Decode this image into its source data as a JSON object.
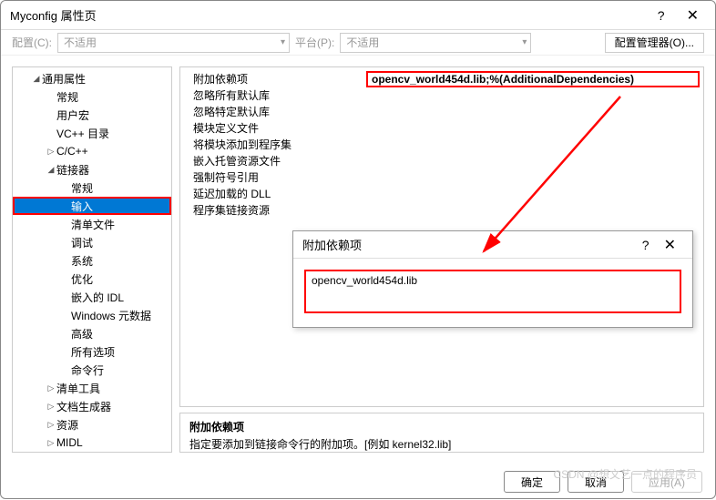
{
  "titlebar": {
    "title": "Myconfig 属性页",
    "help_label": "?",
    "close_label": "✕"
  },
  "config_row": {
    "config_label": "配置(C):",
    "config_value": "不适用",
    "platform_label": "平台(P):",
    "platform_value": "不适用",
    "manager_btn": "配置管理器(O)..."
  },
  "tree": {
    "root": "通用属性",
    "items": [
      "常规",
      "用户宏",
      "VC++ 目录",
      "C/C++",
      "链接器"
    ],
    "linker_children": [
      "常规",
      "输入",
      "清单文件",
      "调试",
      "系统",
      "优化",
      "嵌入的 IDL",
      "Windows 元数据",
      "高级",
      "所有选项",
      "命令行"
    ],
    "tail_items": [
      "清单工具",
      "文档生成器",
      "资源",
      "MIDL"
    ]
  },
  "properties": {
    "rows": [
      {
        "label": "附加依赖项",
        "value": "opencv_world454d.lib;%(AdditionalDependencies)"
      },
      {
        "label": "忽略所有默认库",
        "value": ""
      },
      {
        "label": "忽略特定默认库",
        "value": ""
      },
      {
        "label": "模块定义文件",
        "value": ""
      },
      {
        "label": "将模块添加到程序集",
        "value": ""
      },
      {
        "label": "嵌入托管资源文件",
        "value": ""
      },
      {
        "label": "强制符号引用",
        "value": ""
      },
      {
        "label": "延迟加载的 DLL",
        "value": ""
      },
      {
        "label": "程序集链接资源",
        "value": ""
      }
    ]
  },
  "description": {
    "title": "附加依赖项",
    "text": "指定要添加到链接命令行的附加项。[例如 kernel32.lib]"
  },
  "popup": {
    "title": "附加依赖项",
    "help_label": "?",
    "close_label": "✕",
    "value": "opencv_world454d.lib"
  },
  "buttons": {
    "ok": "确定",
    "cancel": "取消",
    "apply": "应用(A)"
  },
  "watermark": "CSDN @想文艺一点的程序员"
}
